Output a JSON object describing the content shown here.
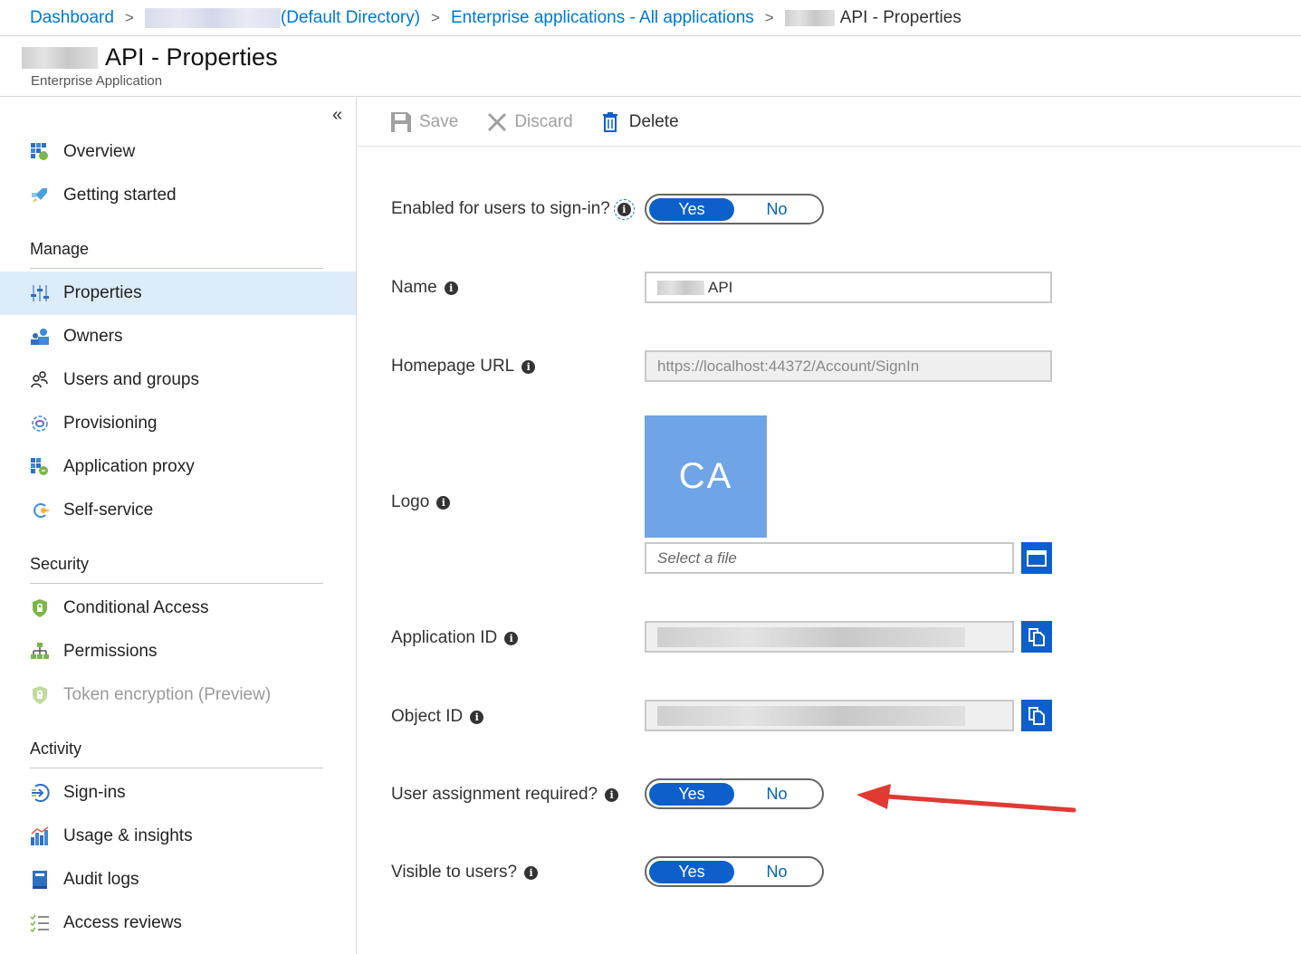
{
  "breadcrumb": {
    "dashboard": "Dashboard",
    "directory": "(Default Directory)",
    "enterprise_apps": "Enterprise applications - All applications",
    "current": "API - Properties"
  },
  "header": {
    "title": "API - Properties",
    "subtitle": "Enterprise Application"
  },
  "sidebar": {
    "collapse_glyph": "«",
    "items_top": [
      {
        "label": "Overview",
        "icon": "overview-grid-icon"
      },
      {
        "label": "Getting started",
        "icon": "rocket-icon"
      }
    ],
    "manage": {
      "title": "Manage",
      "items": [
        {
          "label": "Properties",
          "icon": "properties-sliders-icon",
          "active": true
        },
        {
          "label": "Owners",
          "icon": "owners-people-icon"
        },
        {
          "label": "Users and groups",
          "icon": "users-groups-icon"
        },
        {
          "label": "Provisioning",
          "icon": "provisioning-sync-icon"
        },
        {
          "label": "Application proxy",
          "icon": "app-proxy-icon"
        },
        {
          "label": "Self-service",
          "icon": "self-service-icon"
        }
      ]
    },
    "security": {
      "title": "Security",
      "items": [
        {
          "label": "Conditional Access",
          "icon": "shield-lock-icon"
        },
        {
          "label": "Permissions",
          "icon": "permissions-tree-icon"
        },
        {
          "label": "Token encryption (Preview)",
          "icon": "shield-lock-icon",
          "disabled": true
        }
      ]
    },
    "activity": {
      "title": "Activity",
      "items": [
        {
          "label": "Sign-ins",
          "icon": "sign-in-arrow-icon"
        },
        {
          "label": "Usage & insights",
          "icon": "bar-chart-icon"
        },
        {
          "label": "Audit logs",
          "icon": "audit-book-icon"
        },
        {
          "label": "Access reviews",
          "icon": "checklist-icon"
        }
      ]
    }
  },
  "toolbar": {
    "save": "Save",
    "discard": "Discard",
    "delete": "Delete"
  },
  "form": {
    "enabled": {
      "label": "Enabled for users to sign-in?",
      "yes": "Yes",
      "no": "No",
      "value": "Yes"
    },
    "name": {
      "label": "Name",
      "value": "API"
    },
    "homepage": {
      "label": "Homepage URL",
      "value": "https://localhost:44372/Account/SignIn"
    },
    "logo": {
      "label": "Logo",
      "initials": "CA",
      "file_placeholder": "Select a file"
    },
    "app_id": {
      "label": "Application ID"
    },
    "object_id": {
      "label": "Object ID"
    },
    "assignment": {
      "label": "User assignment required?",
      "yes": "Yes",
      "no": "No",
      "value": "Yes"
    },
    "visible": {
      "label": "Visible to users?",
      "yes": "Yes",
      "no": "No",
      "value": "Yes"
    }
  },
  "colors": {
    "accent": "#0078d4",
    "toggle_on": "#0d5fcc",
    "logo_bg": "#6fa4e6",
    "active_nav": "#ddecfa",
    "annotation_arrow": "#e03a33"
  }
}
